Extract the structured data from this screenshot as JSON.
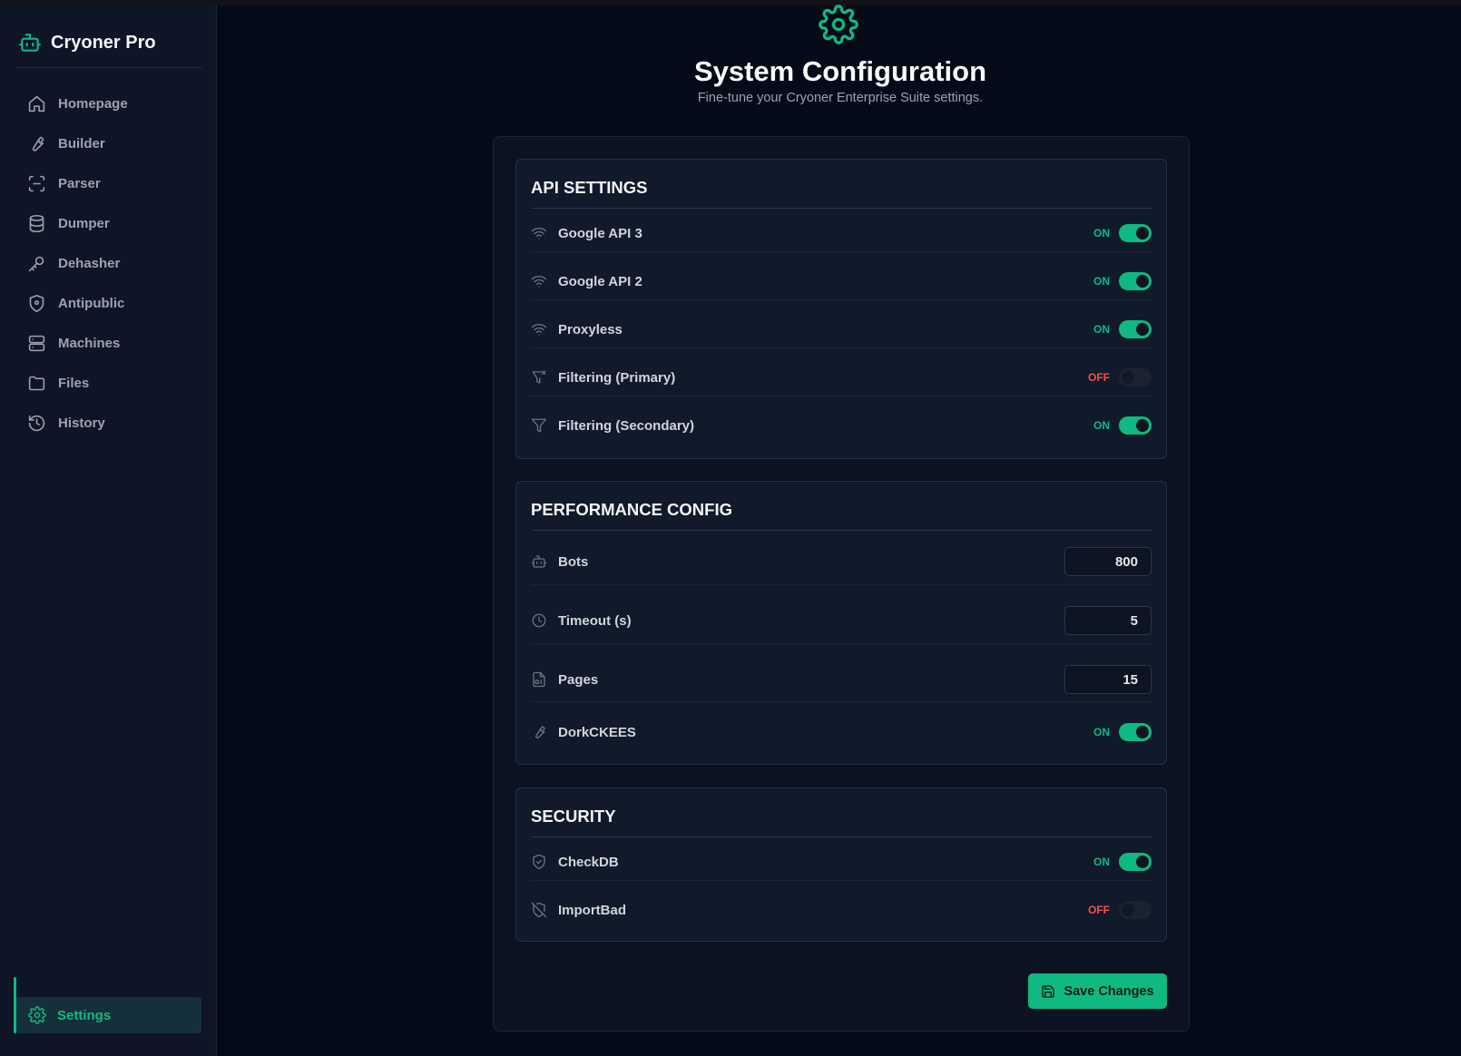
{
  "app": {
    "name": "Cryoner Pro"
  },
  "colors": {
    "accent": "#10b981",
    "off": "#f05252",
    "background": "#050a18",
    "sidebar": "#0d1526"
  },
  "sidebar": {
    "items": [
      {
        "label": "Homepage",
        "icon": "home-icon"
      },
      {
        "label": "Builder",
        "icon": "wrench-icon"
      },
      {
        "label": "Parser",
        "icon": "scan-icon"
      },
      {
        "label": "Dumper",
        "icon": "database-icon"
      },
      {
        "label": "Dehasher",
        "icon": "key-icon"
      },
      {
        "label": "Antipublic",
        "icon": "shield-icon"
      },
      {
        "label": "Machines",
        "icon": "server-icon"
      },
      {
        "label": "Files",
        "icon": "folder-icon"
      },
      {
        "label": "History",
        "icon": "history-icon"
      }
    ],
    "settings": {
      "label": "Settings",
      "icon": "gear-icon",
      "active": true
    }
  },
  "header": {
    "title": "System Configuration",
    "subtitle": "Fine-tune your Cryoner Enterprise Suite settings."
  },
  "sections": {
    "api": {
      "title": "API SETTINGS",
      "rows": [
        {
          "label": "Google API 3",
          "state": "ON",
          "icon": "wifi-icon"
        },
        {
          "label": "Google API 2",
          "state": "ON",
          "icon": "wifi-icon"
        },
        {
          "label": "Proxyless",
          "state": "ON",
          "icon": "wifi-icon"
        },
        {
          "label": "Filtering (Primary)",
          "state": "OFF",
          "icon": "filter-x-icon"
        },
        {
          "label": "Filtering (Secondary)",
          "state": "ON",
          "icon": "filter-icon"
        }
      ]
    },
    "performance": {
      "title": "PERFORMANCE CONFIG",
      "bots": {
        "label": "Bots",
        "value": "800",
        "icon": "bot-icon"
      },
      "timeout": {
        "label": "Timeout (s)",
        "value": "5",
        "icon": "clock-icon"
      },
      "pages": {
        "label": "Pages",
        "value": "15",
        "icon": "file-digit-icon"
      },
      "dork": {
        "label": "DorkCKEES",
        "state": "ON",
        "icon": "wrench-icon"
      }
    },
    "security": {
      "title": "SECURITY",
      "rows": [
        {
          "label": "CheckDB",
          "state": "ON",
          "icon": "shield-check-icon"
        },
        {
          "label": "ImportBad",
          "state": "OFF",
          "icon": "shield-off-icon"
        }
      ]
    }
  },
  "actions": {
    "save_label": "Save Changes",
    "save_icon": "save-icon"
  }
}
